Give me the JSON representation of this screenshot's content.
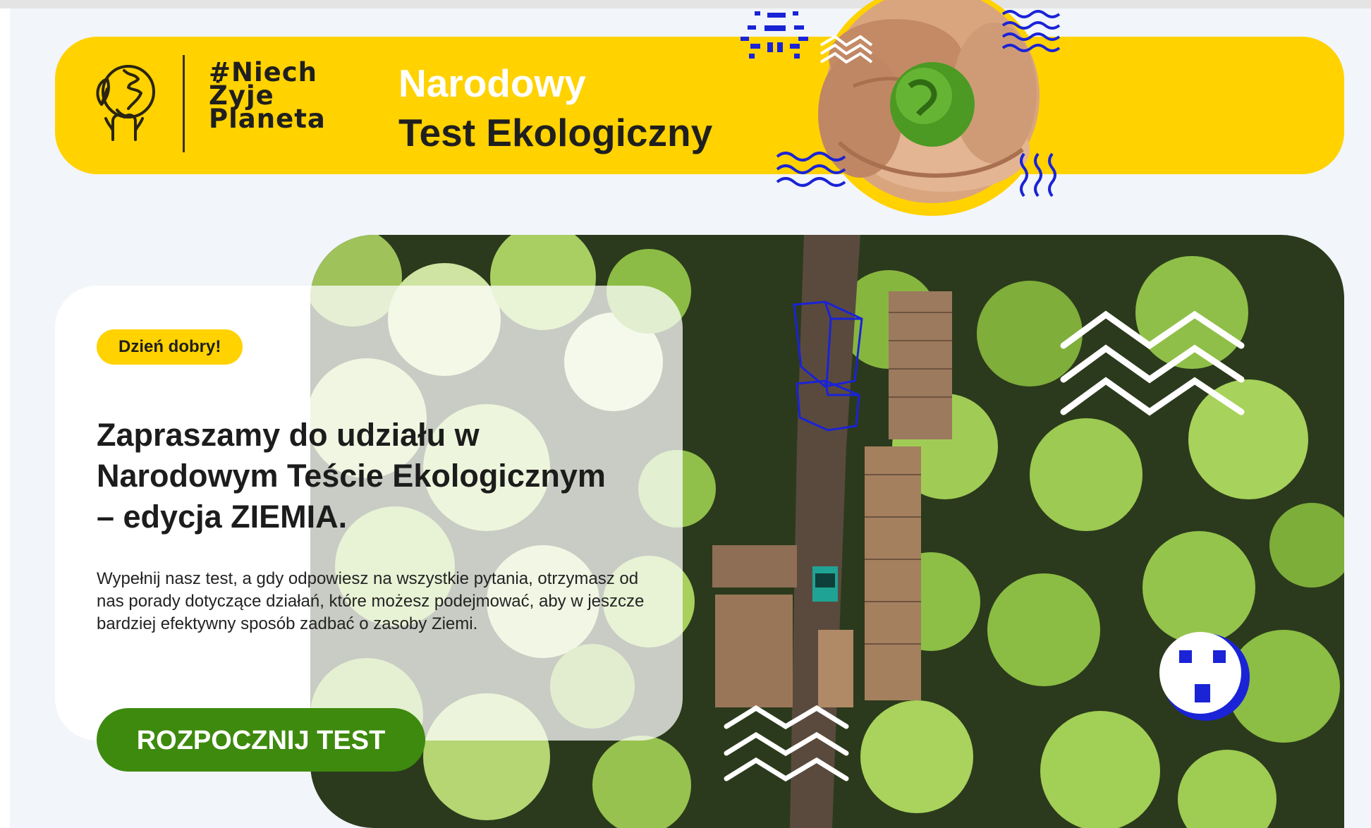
{
  "header": {
    "hashtag": [
      "#Niech",
      "Żyje",
      "Planeta"
    ],
    "title_line1": "Narodowy",
    "title_line2": "Test Ekologiczny"
  },
  "card": {
    "badge": "Dzień dobry!",
    "heading_lines": [
      "Zapraszamy do udziału w",
      "Narodowym Teście Ekologicznym",
      "– edycja ZIEMIA."
    ],
    "description": "Wypełnij nasz test, a gdy odpowiesz na wszystkie pytania, otrzymasz od nas porady dotyczące działań, które możesz podejmować, aby w jeszcze bardziej efektywny sposób zadbać o zasoby Ziemi.",
    "cta_label": "ROZPOCZNIJ TEST"
  },
  "colors": {
    "brand_yellow": "#ffd200",
    "cta_green": "#3e8a0e",
    "accent_blue": "#1a23d6",
    "background": "#f2f5f9"
  },
  "icons": [
    "earth-hands-logo-icon",
    "sun-doodle-icon",
    "zigzag-icon",
    "wave-doodle-icon",
    "face-doodle-icon",
    "box-doodle-icon"
  ]
}
